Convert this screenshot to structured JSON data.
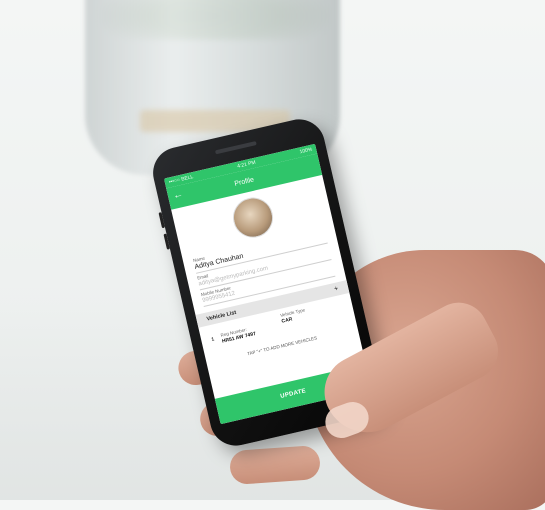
{
  "status": {
    "carrier": "•••○○ BELL",
    "time": "4:21 PM",
    "battery": "100%"
  },
  "appbar": {
    "title": "Profile"
  },
  "profile": {
    "name_label": "Name",
    "name_value": "Aditya Chauhan",
    "email_label": "Email",
    "email_value": "aditya@getmyparking.com",
    "mobile_label": "Mobile Number",
    "mobile_value": "9999955412"
  },
  "vehicles": {
    "header": "Vehicle List",
    "add_icon": "+",
    "rows": [
      {
        "index": "1",
        "reg_label": "Reg Number:",
        "reg_value": "HR51 AW 7497",
        "type_label": "Vehicle Type",
        "type_value": "CAR"
      }
    ],
    "hint": "TAP \"+\" TO ADD MORE VEHICLES"
  },
  "actions": {
    "update_label": "UPDATE"
  },
  "colors": {
    "accent": "#2fc56a",
    "section_bg": "#e5e5e5"
  }
}
